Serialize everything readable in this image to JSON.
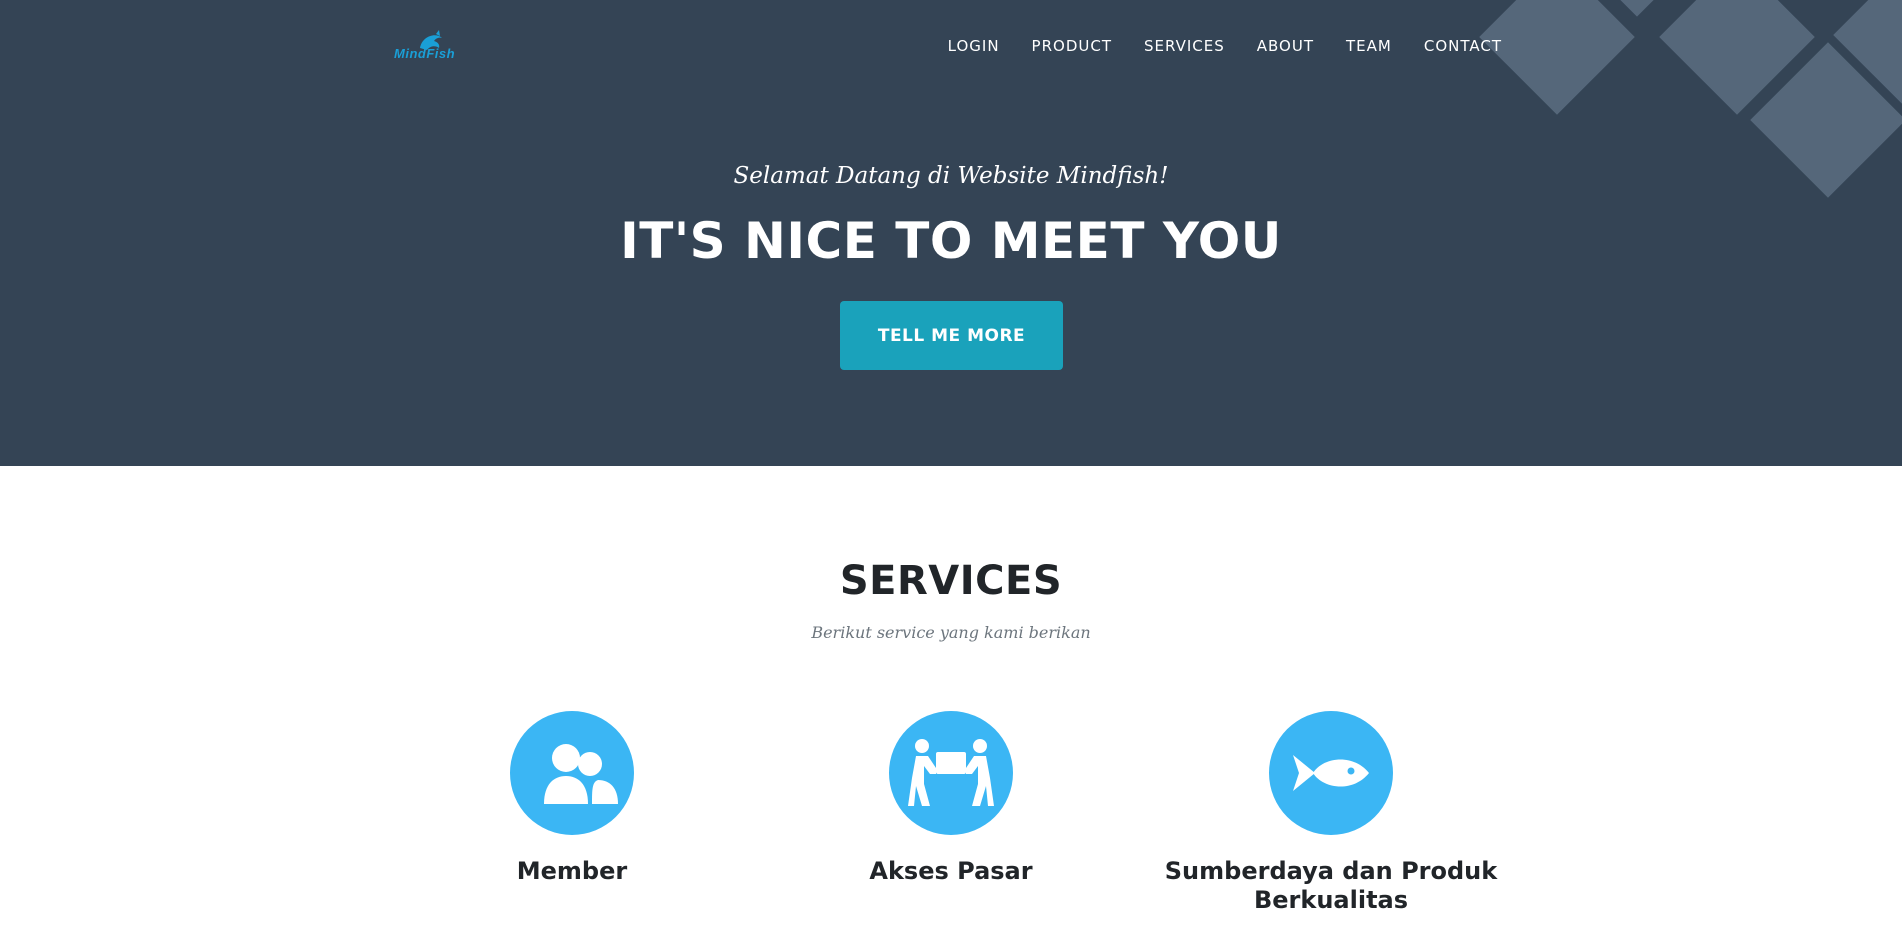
{
  "brand": {
    "logo_text": "MindFish"
  },
  "nav": {
    "items": [
      {
        "label": "LOGIN"
      },
      {
        "label": "PRODUCT"
      },
      {
        "label": "SERVICES"
      },
      {
        "label": "ABOUT"
      },
      {
        "label": "TEAM"
      },
      {
        "label": "CONTACT"
      }
    ]
  },
  "hero": {
    "subtitle": "Selamat Datang di Website Mindfish!",
    "title": "IT'S NICE TO MEET YOU",
    "button_label": "TELL ME MORE"
  },
  "services": {
    "heading": "SERVICES",
    "subheading": "Berikut service yang kami berikan",
    "items": [
      {
        "title": "Member",
        "icon": "users-icon"
      },
      {
        "title": "Akses Pasar",
        "icon": "people-carry-icon"
      },
      {
        "title": "Sumberdaya dan Produk Berkualitas",
        "icon": "fish-icon"
      }
    ]
  },
  "colors": {
    "hero_background": "#344455",
    "accent_button": "#1aa2bb",
    "service_icon_circle": "#3bb6f4",
    "decor_diamond": "#55677a"
  }
}
